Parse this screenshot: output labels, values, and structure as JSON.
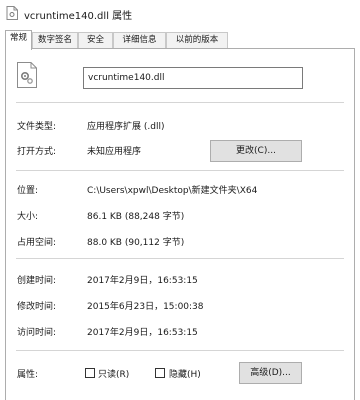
{
  "window": {
    "title": "vcruntime140.dll 属性"
  },
  "tabs": [
    {
      "label": "常规",
      "active": true
    },
    {
      "label": "数字签名",
      "active": false
    },
    {
      "label": "安全",
      "active": false
    },
    {
      "label": "详细信息",
      "active": false
    },
    {
      "label": "以前的版本",
      "active": false
    }
  ],
  "file": {
    "name": "vcruntime140.dll"
  },
  "rows": {
    "type": {
      "label": "文件类型:",
      "value": "应用程序扩展 (.dll)"
    },
    "opens_with": {
      "label": "打开方式:",
      "value": "未知应用程序",
      "button": "更改(C)..."
    },
    "location": {
      "label": "位置:",
      "value": "C:\\Users\\xpwl\\Desktop\\新建文件夹\\X64"
    },
    "size": {
      "label": "大小:",
      "value": "86.1 KB (88,248 字节)"
    },
    "size_on_disk": {
      "label": "占用空间:",
      "value": "88.0 KB (90,112 字节)"
    },
    "created": {
      "label": "创建时间:",
      "value": "2017年2月9日，16:53:15"
    },
    "modified": {
      "label": "修改时间:",
      "value": "2015年6月23日，15:00:38"
    },
    "accessed": {
      "label": "访问时间:",
      "value": "2017年2月9日，16:53:15"
    },
    "attributes": {
      "label": "属性:",
      "readonly_label": "只读(R)",
      "readonly_checked": false,
      "hidden_label": "隐藏(H)",
      "hidden_checked": false,
      "advanced_button": "高级(D)..."
    }
  },
  "icons": {
    "title_icon": "dll-file-icon",
    "file_icon": "dll-gear-file-icon"
  }
}
